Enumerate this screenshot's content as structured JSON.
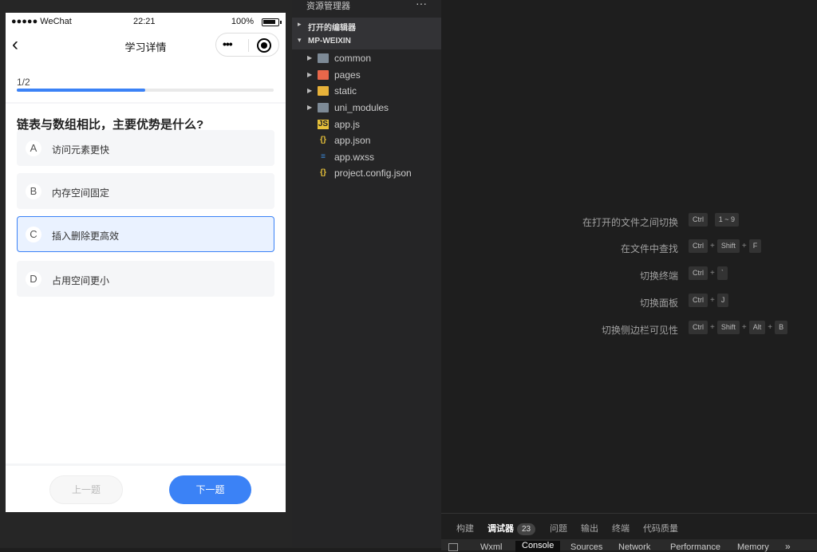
{
  "phone": {
    "status": {
      "signal": "●●●●● WeChat",
      "time": "22:21",
      "battery": "100%"
    },
    "nav": {
      "back": "‹",
      "title": "学习详情",
      "more": "•••"
    },
    "progress": {
      "text": "1/2",
      "fraction": 0.5
    },
    "question": "链表与数组相比，主要优势是什么?",
    "options": [
      {
        "letter": "A",
        "text": "访问元素更快",
        "selected": false
      },
      {
        "letter": "B",
        "text": "内存空间固定",
        "selected": false
      },
      {
        "letter": "C",
        "text": "插入删除更高效",
        "selected": true
      },
      {
        "letter": "D",
        "text": "占用空间更小",
        "selected": false
      }
    ],
    "buttons": {
      "prev": "上一题",
      "next": "下一题"
    }
  },
  "explorer": {
    "title": "资源管理器",
    "more": "···",
    "sections": {
      "open_editors": "打开的编辑器",
      "project": "MP-WEIXIN"
    },
    "items": [
      {
        "name": "common",
        "icon": "folder-icon",
        "expandable": true
      },
      {
        "name": "pages",
        "icon": "folder-pages-icon",
        "expandable": true
      },
      {
        "name": "static",
        "icon": "folder-static-icon",
        "expandable": true
      },
      {
        "name": "uni_modules",
        "icon": "folder-icon",
        "expandable": true
      },
      {
        "name": "app.js",
        "icon": "js-file-icon",
        "expandable": false
      },
      {
        "name": "app.json",
        "icon": "json-file-icon",
        "expandable": false
      },
      {
        "name": "app.wxss",
        "icon": "css-file-icon",
        "expandable": false
      },
      {
        "name": "project.config.json",
        "icon": "json-file-icon",
        "expandable": false
      }
    ]
  },
  "shortcuts": [
    {
      "desc": "在打开的文件之间切换",
      "keys": [
        "Ctrl",
        "1 ~ 9"
      ]
    },
    {
      "desc": "在文件中查找",
      "keys": [
        "Ctrl",
        "Shift",
        "F"
      ]
    },
    {
      "desc": "切换终端",
      "keys": [
        "Ctrl",
        "`"
      ]
    },
    {
      "desc": "切换面板",
      "keys": [
        "Ctrl",
        "J"
      ]
    },
    {
      "desc": "切换侧边栏可见性",
      "keys": [
        "Ctrl",
        "Shift",
        "Alt",
        "B"
      ]
    }
  ],
  "panel": {
    "tabs": [
      "构建",
      "调试器",
      "问题",
      "输出",
      "终端",
      "代码质量"
    ],
    "active_tab": "调试器",
    "debugger_badge": "23",
    "devtools_tabs": [
      "Wxml",
      "Console",
      "Sources",
      "Network",
      "Performance",
      "Memory"
    ],
    "active_devtools_tab": "Console",
    "overflow": "»"
  },
  "colors": {
    "accent": "#3b82f6",
    "editor_bg": "#1e1e1e",
    "sidebar_bg": "#252526"
  }
}
